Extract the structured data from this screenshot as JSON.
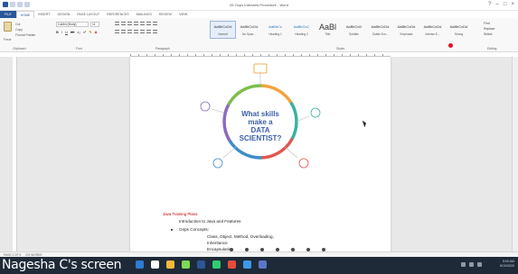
{
  "window": {
    "title": "05 Oops Interview Procedure - Word"
  },
  "ribbon_tabs": [
    "FILE",
    "HOME",
    "INSERT",
    "DESIGN",
    "PAGE LAYOUT",
    "REFERENCES",
    "MAILINGS",
    "REVIEW",
    "VIEW"
  ],
  "ribbon": {
    "clipboard": {
      "cut": "Cut",
      "copy": "Copy",
      "format_painter": "Format Painter",
      "paste": "Paste",
      "label": "Clipboard"
    },
    "font": {
      "name": "Calibri (Body)",
      "size": "11",
      "label": "Font"
    },
    "paragraph": {
      "label": "Paragraph"
    },
    "styles": [
      {
        "sample": "AaBbCcDd",
        "name": "Normal"
      },
      {
        "sample": "AaBbCcDd",
        "name": "No Spac..."
      },
      {
        "sample": "AaBbCc",
        "name": "Heading 1"
      },
      {
        "sample": "AaBbCcC",
        "name": "Heading 2"
      },
      {
        "sample": "AaBl",
        "name": "Title"
      },
      {
        "sample": "AaBbCcD",
        "name": "Subtitle"
      },
      {
        "sample": "AaBbCcDd",
        "name": "Subtle Em..."
      },
      {
        "sample": "AaBbCcDd",
        "name": "Emphasis"
      },
      {
        "sample": "AaBbCcDd",
        "name": "Intense E..."
      },
      {
        "sample": "AaBbCcDd",
        "name": "Strong"
      },
      {
        "sample": "AaBbCcDd",
        "name": "Quote"
      }
    ],
    "styles_label": "Styles",
    "editing": {
      "find": "Find",
      "replace": "Replace",
      "select": "Select",
      "label": "Editing"
    }
  },
  "diagram": {
    "center_text": [
      "What skills",
      "make a",
      "DATA",
      "SCIENTIST?"
    ],
    "ring_colors": [
      "#f3a33c",
      "#37b3a2",
      "#e1574d",
      "#3b8ec9",
      "#8a6bbf",
      "#7cbf4e"
    ]
  },
  "document": {
    "heading": "Java Training Plans:",
    "intro": "Introduction to Java and Features",
    "bullet": "Oops Concepts:",
    "sub_items": [
      "Class, Object, Method, Overloading,",
      "Inheritance",
      "Encapsulation"
    ]
  },
  "status": {
    "page": "PAGE 1 OF 5",
    "words": "276 WORDS"
  },
  "taskbar": {
    "screen_label": "Nagesha C's screen",
    "time": "9:09 AM",
    "date": "6/10/2020",
    "icon_colors": [
      "#2d7dd2",
      "#ffffff",
      "#f6b93b",
      "#7ed957",
      "#2b579a",
      "#2ecc71",
      "#e74c3c",
      "#3d9be9",
      "#5a76c9"
    ]
  }
}
